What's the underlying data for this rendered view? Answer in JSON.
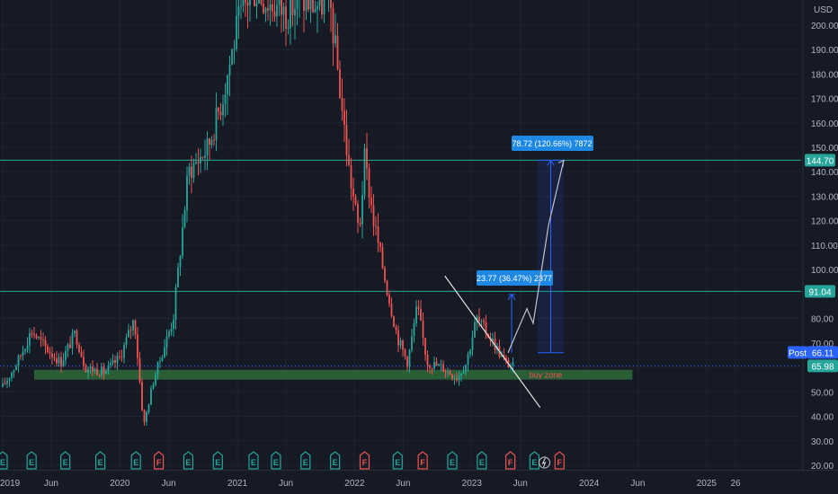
{
  "chart_data": {
    "type": "candlestick",
    "currency": "USD",
    "y_ticks": [
      200,
      190,
      180,
      170,
      160,
      150,
      140,
      130,
      120,
      110,
      100,
      80,
      70,
      60,
      50,
      40,
      30,
      20
    ],
    "y_tick_labels": [
      "200.00",
      "190.00",
      "180.00",
      "170.00",
      "160.00",
      "150.00",
      "140.00",
      "130.00",
      "120.00",
      "110.00",
      "100.00",
      "80.00",
      "70.00",
      "60.00",
      "50.00",
      "40.00",
      "30.00",
      "20.00"
    ],
    "y_range": [
      17,
      212
    ],
    "x_range": [
      "2019-01-01",
      "2026-04-01"
    ],
    "x_ticks": [
      {
        "label": "2019",
        "date": "2019-01-01"
      },
      {
        "label": "Jun",
        "date": "2019-06-01"
      },
      {
        "label": "2020",
        "date": "2020-01-01"
      },
      {
        "label": "Jun",
        "date": "2020-06-01"
      },
      {
        "label": "2021",
        "date": "2021-01-01"
      },
      {
        "label": "Jun",
        "date": "2021-06-01"
      },
      {
        "label": "2022",
        "date": "2022-01-01"
      },
      {
        "label": "Jun",
        "date": "2022-06-01"
      },
      {
        "label": "2023",
        "date": "2023-01-01"
      },
      {
        "label": "Jun",
        "date": "2023-06-01"
      },
      {
        "label": "2024",
        "date": "2024-01-01"
      },
      {
        "label": "Jun",
        "date": "2024-06-01"
      },
      {
        "label": "2025",
        "date": "2025-01-01"
      },
      {
        "label": "26",
        "date": "2025-04-01"
      }
    ],
    "price_path": [
      [
        "2019-01-01",
        52
      ],
      [
        "2019-02-15",
        62
      ],
      [
        "2019-04-01",
        75
      ],
      [
        "2019-05-15",
        68
      ],
      [
        "2019-07-01",
        62
      ],
      [
        "2019-08-15",
        74
      ],
      [
        "2019-09-15",
        60
      ],
      [
        "2019-11-15",
        58
      ],
      [
        "2020-01-01",
        64
      ],
      [
        "2020-02-15",
        80
      ],
      [
        "2020-03-15",
        36
      ],
      [
        "2020-04-15",
        55
      ],
      [
        "2020-06-15",
        80
      ],
      [
        "2020-08-01",
        140
      ],
      [
        "2020-10-01",
        150
      ],
      [
        "2020-11-15",
        170
      ],
      [
        "2021-01-01",
        200
      ],
      [
        "2021-02-15",
        215
      ],
      [
        "2021-04-01",
        210
      ],
      [
        "2021-06-01",
        205
      ],
      [
        "2021-07-15",
        210
      ],
      [
        "2021-09-01",
        208
      ],
      [
        "2021-10-15",
        210
      ],
      [
        "2021-11-15",
        175
      ],
      [
        "2021-12-15",
        140
      ],
      [
        "2022-01-15",
        115
      ],
      [
        "2022-02-01",
        145
      ],
      [
        "2022-03-01",
        120
      ],
      [
        "2022-04-15",
        90
      ],
      [
        "2022-05-15",
        72
      ],
      [
        "2022-06-15",
        62
      ],
      [
        "2022-07-15",
        85
      ],
      [
        "2022-08-15",
        62
      ],
      [
        "2022-10-01",
        60
      ],
      [
        "2022-11-15",
        56
      ],
      [
        "2022-12-15",
        62
      ],
      [
        "2023-01-15",
        80
      ],
      [
        "2023-03-01",
        72
      ],
      [
        "2023-04-15",
        62
      ],
      [
        "2023-05-15",
        60
      ]
    ],
    "horizontal_levels": [
      {
        "price": 144.7,
        "label": "144.70",
        "color": "#26a69a"
      },
      {
        "price": 91.04,
        "label": "91.04",
        "color": "#26a69a"
      }
    ],
    "last_price": {
      "label": "Post",
      "value": "66.11",
      "close": "65.98",
      "price": 66.11
    },
    "buy_zone": {
      "label": "buy zone",
      "low": 55,
      "high": 59,
      "start": "2019-01-01",
      "end": "2024-05-15",
      "color": "#2e6b3b"
    },
    "trendline": {
      "start": [
        "2023-01-01",
        90
      ],
      "end": [
        "2023-06-15",
        48
      ]
    },
    "projection_path": [
      [
        "2023-06-01",
        65.98
      ],
      [
        "2023-08-01",
        84
      ],
      [
        "2023-09-01",
        78
      ],
      [
        "2023-11-01",
        118
      ],
      [
        "2023-12-01",
        144.7
      ]
    ],
    "measure_boxes": [
      {
        "label": "23.77 (36.47%) 2377",
        "from_price": 65.98,
        "to_price": 89.75,
        "at": "2023-06-03",
        "color": "#2962ff"
      },
      {
        "label": "78.72 (120.66%) 7872",
        "from_price": 65.98,
        "to_price": 144.7,
        "from_date": "2023-09-01",
        "to_date": "2023-12-01",
        "color": "#2962ff"
      }
    ],
    "event_markers": [
      {
        "type": "E",
        "date": "2019-01-01"
      },
      {
        "type": "E",
        "date": "2019-04-01"
      },
      {
        "type": "E",
        "date": "2019-07-15"
      },
      {
        "type": "E",
        "date": "2019-11-01"
      },
      {
        "type": "E",
        "date": "2020-02-20"
      },
      {
        "type": "F",
        "date": "2020-05-01"
      },
      {
        "type": "E",
        "date": "2020-08-01"
      },
      {
        "type": "E",
        "date": "2020-11-01"
      },
      {
        "type": "E",
        "date": "2021-02-20"
      },
      {
        "type": "E",
        "date": "2021-05-01"
      },
      {
        "type": "E",
        "date": "2021-08-01"
      },
      {
        "type": "E",
        "date": "2021-11-01"
      },
      {
        "type": "F",
        "date": "2022-02-01"
      },
      {
        "type": "E",
        "date": "2022-05-15"
      },
      {
        "type": "F",
        "date": "2022-08-01"
      },
      {
        "type": "E",
        "date": "2022-11-01"
      },
      {
        "type": "E",
        "date": "2023-02-01"
      },
      {
        "type": "F",
        "date": "2023-05-01"
      },
      {
        "type": "E",
        "date": "2023-07-15"
      },
      {
        "type": "bolt",
        "date": "2023-08-15"
      },
      {
        "type": "F",
        "date": "2023-10-01"
      }
    ]
  }
}
